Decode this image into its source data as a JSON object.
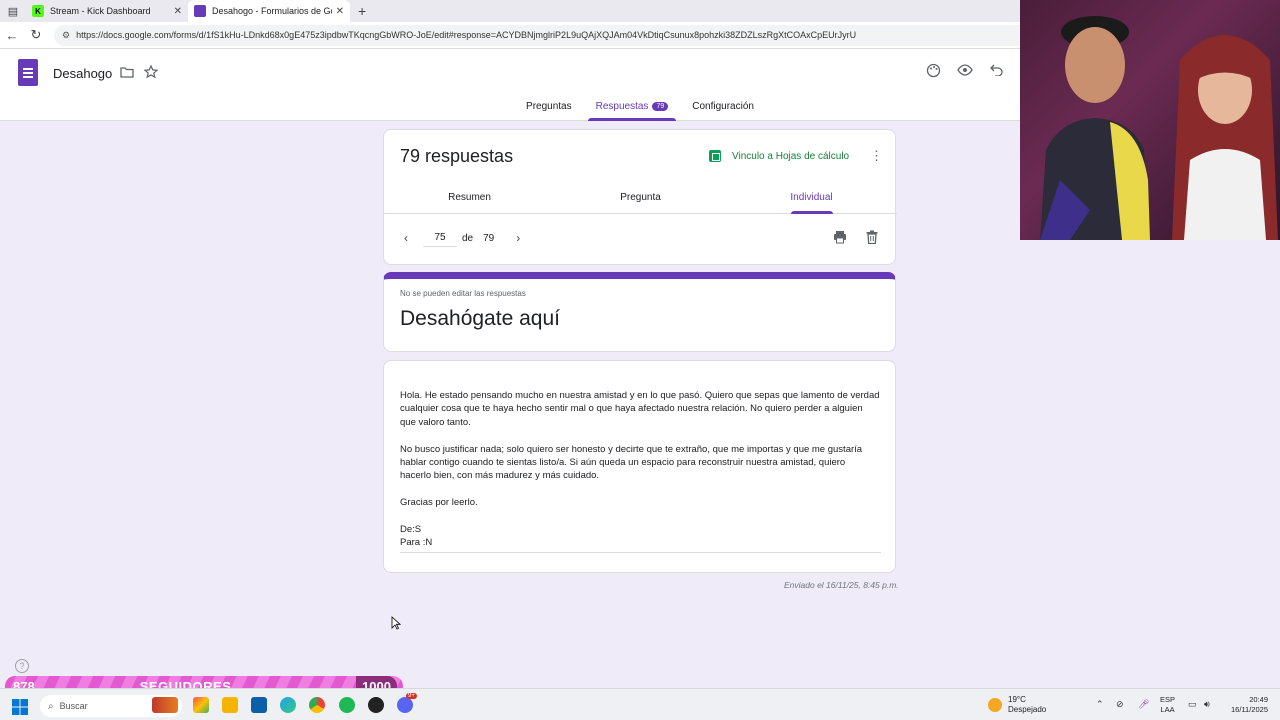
{
  "browser": {
    "tabs": [
      {
        "title": "Stream - Kick Dashboard",
        "favicon": "kick-icon",
        "active": false
      },
      {
        "title": "Desahogo - Formularios de Goog",
        "favicon": "forms-icon",
        "active": true
      }
    ],
    "url": "https://docs.google.com/forms/d/1fS1kHu-LDnkd68x0gE475z3ipdbwTKqcngGbWRO-JoE/edit#response=ACYDBNjmglriP2L9uQAjXQJAm04VkDtiqCsunux8pohzki38ZDZLszRgXtCOAxCpEUrJyrU"
  },
  "forms": {
    "doc_title": "Desahogo",
    "tabs": {
      "preguntas": "Preguntas",
      "respuestas": "Respuestas",
      "respuestas_badge": "79",
      "configuracion": "Configuración"
    }
  },
  "responses": {
    "count_label": "79 respuestas",
    "sheets_link": "Vinculo a Hojas de cálculo",
    "tabs": {
      "resumen": "Resumen",
      "pregunta": "Pregunta",
      "individual": "Individual"
    },
    "pager": {
      "current": "75",
      "of": "de",
      "total": "79"
    }
  },
  "form_header": {
    "note": "No se pueden editar las respuestas",
    "title": "Desahógate aquí"
  },
  "answer": {
    "text": "Hola. He estado pensando mucho en nuestra amistad y en lo que pasó. Quiero que sepas que lamento de verdad\ncualquier cosa que te haya hecho sentir mal o que haya afectado nuestra relación. No quiero perder a alguien\nque valoro tanto.\n\nNo busco justificar nada; solo quiero ser honesto y decirte que te extraño, que me importas y que me gustaría\nhablar contigo cuando te sientas listo/a. Si aún queda un espacio para reconstruir nuestra amistad, quiero\nhacerlo bien, con más madurez y más cuidado.\n\nGracias por leerlo.\n\nDe:S\nPara :N"
  },
  "sent_label": "Enviado el 16/11/25, 8:45 p.m.",
  "overlay": {
    "followers_current": "878",
    "followers_label": "SEGUIDORES",
    "followers_goal": "1000",
    "progress_fraction": 0.878
  },
  "taskbar": {
    "search_placeholder": "Buscar",
    "weather_temp": "19°C",
    "weather_desc": "Despejado",
    "lang_line1": "ESP",
    "lang_line2": "LAA",
    "time": "20:49",
    "date": "16/11/2025",
    "notification_badge": "9+"
  },
  "colors": {
    "forms_purple": "#673ab7",
    "background": "#f0ebf8",
    "sheets_green": "#188038",
    "overlay_pink": "#e25ad0"
  }
}
